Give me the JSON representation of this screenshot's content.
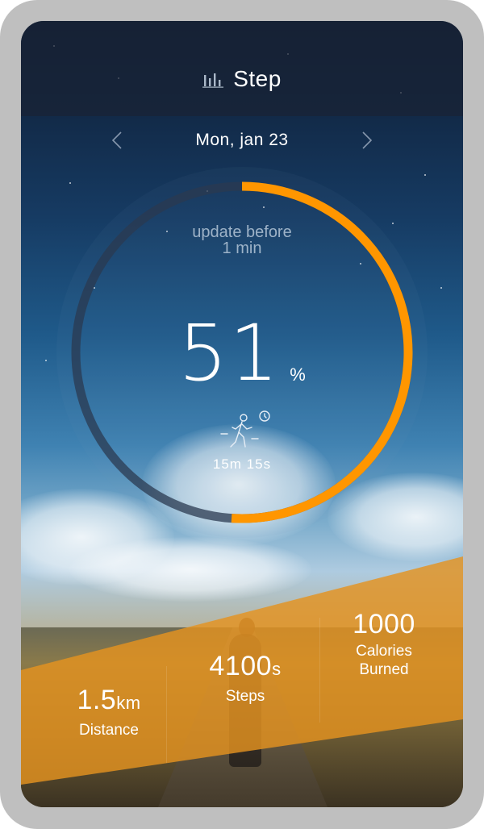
{
  "header": {
    "title": "Step",
    "icon": "bar-chart-icon"
  },
  "date_nav": {
    "date": "Mon, jan 23",
    "prev_icon": "chevron-left-icon",
    "next_icon": "chevron-right-icon"
  },
  "progress": {
    "update_line1": "update before",
    "update_line2": "1 min",
    "value": "51",
    "percent_sign": "%",
    "fraction": 0.51,
    "duration": "15m 15s",
    "activity_icon": "walking-timer-icon"
  },
  "colors": {
    "accent": "#ff9600",
    "track": "#2b3a50",
    "band": "#e49220"
  },
  "stats": {
    "distance": {
      "value": "1.5",
      "unit": "km",
      "label": "Distance"
    },
    "steps": {
      "value": "4100",
      "unit": "s",
      "label": "Steps"
    },
    "calories": {
      "value": "1000",
      "label_line1": "Calories",
      "label_line2": "Burned"
    }
  }
}
